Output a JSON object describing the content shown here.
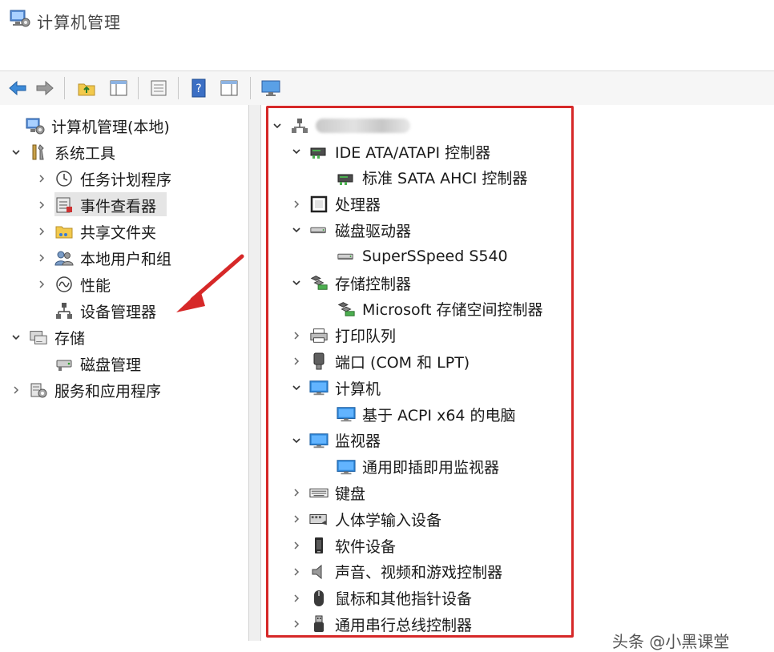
{
  "window": {
    "title": "计算机管理"
  },
  "left_tree": [
    {
      "label": "计算机管理(本地)",
      "icon": "computer-management-icon",
      "chevron": "none"
    },
    {
      "label": "系统工具",
      "icon": "tools-icon",
      "chevron": "expanded"
    },
    {
      "label": "任务计划程序",
      "icon": "clock-icon",
      "chevron": "collapsed"
    },
    {
      "label": "事件查看器",
      "icon": "event-viewer-icon",
      "chevron": "collapsed"
    },
    {
      "label": "共享文件夹",
      "icon": "shared-folder-icon",
      "chevron": "collapsed"
    },
    {
      "label": "本地用户和组",
      "icon": "users-icon",
      "chevron": "collapsed"
    },
    {
      "label": "性能",
      "icon": "performance-icon",
      "chevron": "collapsed"
    },
    {
      "label": "设备管理器",
      "icon": "device-manager-icon",
      "chevron": "none",
      "selected": true
    },
    {
      "label": "存储",
      "icon": "storage-icon",
      "chevron": "expanded"
    },
    {
      "label": "磁盘管理",
      "icon": "disk-management-icon",
      "chevron": "none"
    },
    {
      "label": "服务和应用程序",
      "icon": "services-icon",
      "chevron": "collapsed"
    }
  ],
  "device_tree": [
    {
      "label": "IDE ATA/ATAPI 控制器",
      "icon": "ide-controller-icon",
      "chevron": "expanded"
    },
    {
      "label": "标准 SATA AHCI 控制器",
      "icon": "ide-controller-icon",
      "chevron": "none"
    },
    {
      "label": "处理器",
      "icon": "processor-icon",
      "chevron": "collapsed"
    },
    {
      "label": "磁盘驱动器",
      "icon": "disk-drive-icon",
      "chevron": "expanded"
    },
    {
      "label": "SuperSSpeed S540",
      "icon": "disk-drive-icon",
      "chevron": "none"
    },
    {
      "label": "存储控制器",
      "icon": "storage-controller-icon",
      "chevron": "expanded"
    },
    {
      "label": "Microsoft 存储空间控制器",
      "icon": "storage-controller-icon",
      "chevron": "none"
    },
    {
      "label": "打印队列",
      "icon": "printer-icon",
      "chevron": "collapsed"
    },
    {
      "label": "端口 (COM 和 LPT)",
      "icon": "port-icon",
      "chevron": "collapsed"
    },
    {
      "label": "计算机",
      "icon": "monitor-icon",
      "chevron": "expanded"
    },
    {
      "label": "基于 ACPI x64 的电脑",
      "icon": "monitor-icon",
      "chevron": "none"
    },
    {
      "label": "监视器",
      "icon": "monitor-icon",
      "chevron": "expanded"
    },
    {
      "label": "通用即插即用监视器",
      "icon": "monitor-icon",
      "chevron": "none"
    },
    {
      "label": "键盘",
      "icon": "keyboard-icon",
      "chevron": "collapsed"
    },
    {
      "label": "人体学输入设备",
      "icon": "hid-icon",
      "chevron": "collapsed"
    },
    {
      "label": "软件设备",
      "icon": "software-device-icon",
      "chevron": "collapsed"
    },
    {
      "label": "声音、视频和游戏控制器",
      "icon": "speaker-icon",
      "chevron": "collapsed"
    },
    {
      "label": "鼠标和其他指针设备",
      "icon": "mouse-icon",
      "chevron": "collapsed"
    },
    {
      "label": "通用串行总线控制器",
      "icon": "usb-icon",
      "chevron": "collapsed"
    }
  ],
  "toolbar_icons": [
    "back-icon",
    "forward-icon",
    "up-folder-icon",
    "show-hide-tree-icon",
    "properties-icon",
    "help-icon",
    "action-pane-icon",
    "monitor-display-icon"
  ],
  "colors": {
    "highlight_border": "#d62828",
    "arrow": "#d62828",
    "selection": "#e5e5e5"
  },
  "watermark": "头条 @小黑课堂"
}
